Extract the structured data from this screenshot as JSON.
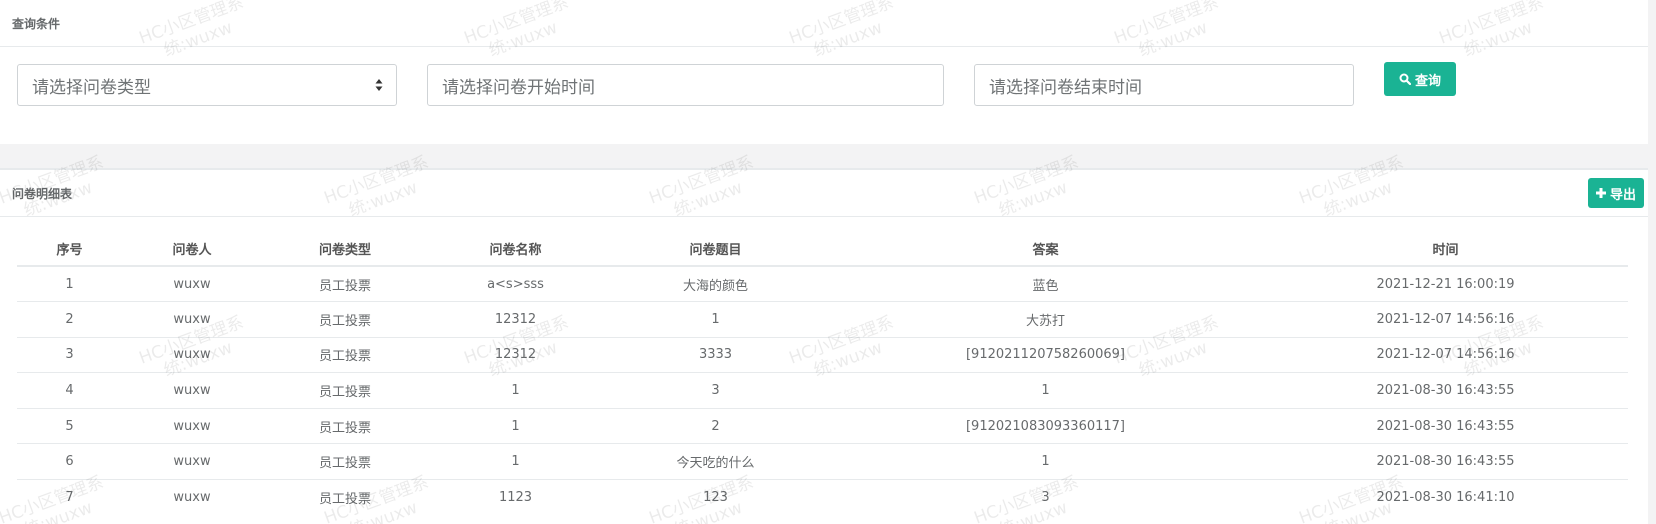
{
  "query": {
    "title": "查询条件",
    "type_placeholder": "请选择问卷类型",
    "start_placeholder": "请选择问卷开始时间",
    "end_placeholder": "请选择问卷结束时间",
    "search_label": "查询"
  },
  "list": {
    "title": "问卷明细表",
    "export_label": "导出",
    "columns": [
      "序号",
      "问卷人",
      "问卷类型",
      "问卷名称",
      "问卷题目",
      "答案",
      "时间"
    ],
    "rows": [
      [
        "1",
        "wuxw",
        "员工投票",
        "a<s>sss",
        "大海的颜色",
        "蓝色",
        "2021-12-21 16:00:19"
      ],
      [
        "2",
        "wuxw",
        "员工投票",
        "12312",
        "1",
        "大苏打",
        "2021-12-07 14:56:16"
      ],
      [
        "3",
        "wuxw",
        "员工投票",
        "12312",
        "3333",
        "[912021120758260069]",
        "2021-12-07 14:56:16"
      ],
      [
        "4",
        "wuxw",
        "员工投票",
        "1",
        "3",
        "1",
        "2021-08-30 16:43:55"
      ],
      [
        "5",
        "wuxw",
        "员工投票",
        "1",
        "2",
        "[912021083093360117]",
        "2021-08-30 16:43:55"
      ],
      [
        "6",
        "wuxw",
        "员工投票",
        "1",
        "今天吃的什么",
        "1",
        "2021-08-30 16:43:55"
      ],
      [
        "7",
        "wuxw",
        "员工投票",
        "1123",
        "123",
        "3",
        "2021-08-30 16:41:10"
      ]
    ]
  },
  "watermark": {
    "line1": "HC小区管理系",
    "line2": "统:wuxw"
  },
  "colors": {
    "accent": "#1ab394",
    "page_bg": "#f3f3f4"
  },
  "icons": {
    "search": "search-icon",
    "export": "plus-icon",
    "select": "sort-arrows-icon"
  }
}
